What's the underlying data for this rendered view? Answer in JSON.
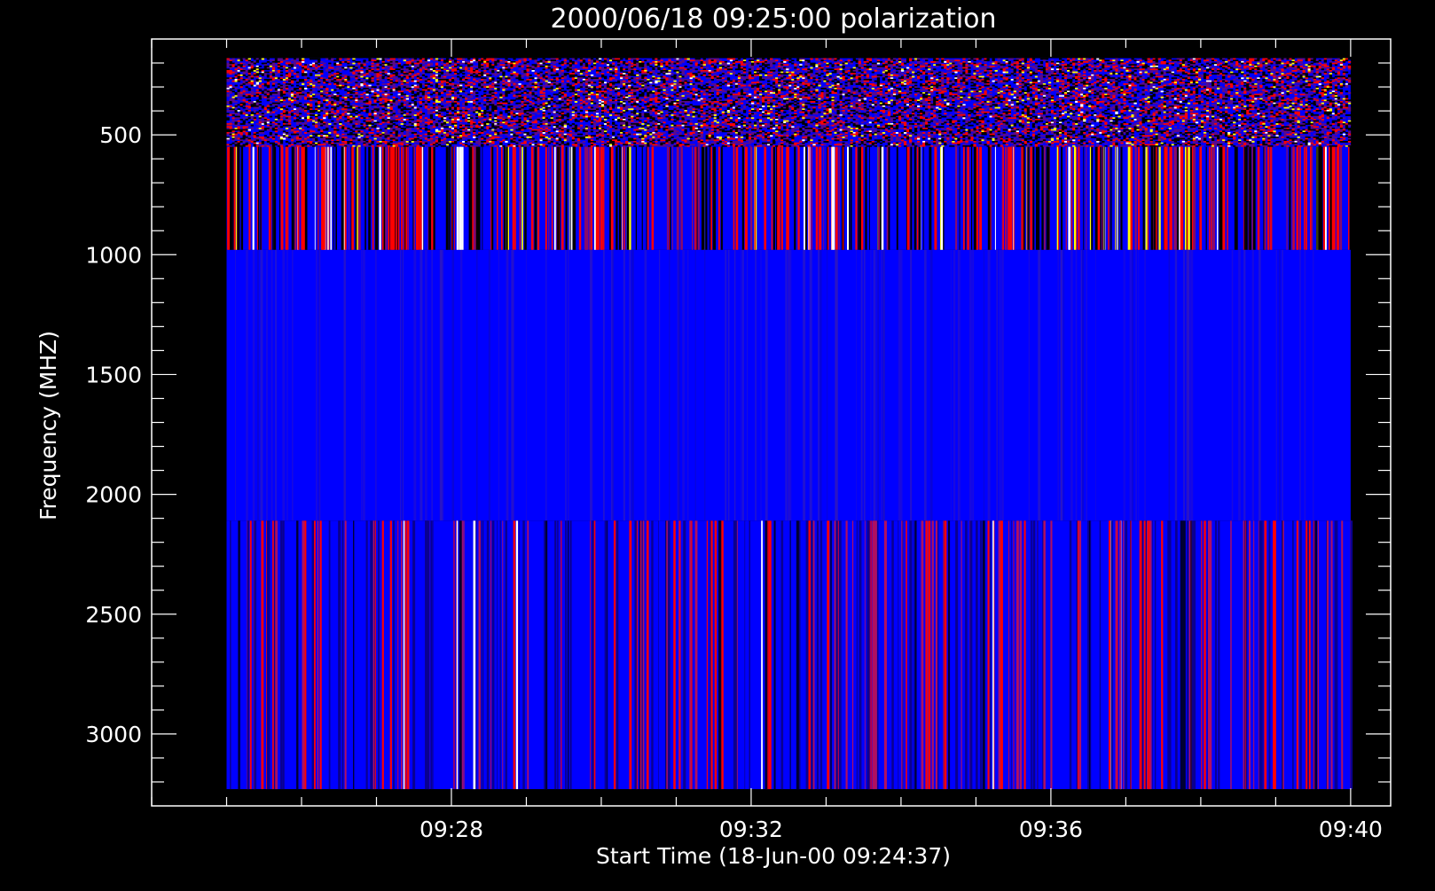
{
  "chart_data": {
    "type": "heatmap",
    "title": "2000/06/18 09:25:00 polarization",
    "xlabel": "Start Time (18-Jun-00 09:24:37)",
    "ylabel": "Frequency (MHZ)",
    "x_tick_labels": [
      "09:28",
      "09:32",
      "09:36",
      "09:40"
    ],
    "x_tick_values_min": [
      3.383,
      7.383,
      11.383,
      15.383
    ],
    "x_minor_step_min": 1,
    "xlim_min": [
      -0.617,
      15.917
    ],
    "data_x_range_min": [
      0.383,
      15.383
    ],
    "y_tick_labels": [
      "500",
      "1000",
      "1500",
      "2000",
      "2500",
      "3000"
    ],
    "y_tick_values": [
      500,
      1000,
      1500,
      2000,
      2500,
      3000
    ],
    "y_minor_step": 100,
    "ylim": [
      3300,
      100
    ],
    "y_reversed": true,
    "frequency_bands_mhz": [
      {
        "from": 180,
        "to": 550,
        "pattern": "speckled noise, horizontal striping"
      },
      {
        "from": 550,
        "to": 980,
        "pattern": "strong vertical stripes, red/white/black on blue"
      },
      {
        "from": 980,
        "to": 2110,
        "pattern": "mostly uniform blue, faint vertical stripes"
      },
      {
        "from": 2110,
        "to": 3230,
        "pattern": "vertical stripes, blue with red/dark accents"
      }
    ],
    "colormap": [
      "#000000",
      "#0000ff",
      "#ff0000",
      "#ffff00",
      "#ffffff"
    ],
    "background_color": "#000000",
    "axis_color": "#ffffff",
    "grid": false,
    "legend": "none"
  }
}
